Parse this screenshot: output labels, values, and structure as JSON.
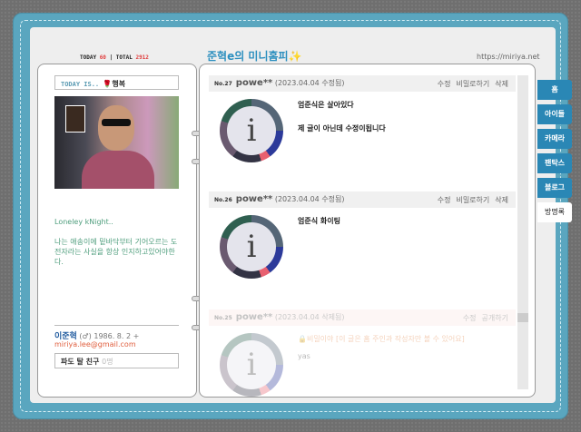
{
  "header": {
    "today_label": "TODAY",
    "today": "60",
    "total_label": "TOTAL",
    "total": "2912",
    "title": "준혁e의 미니홈피✨",
    "url": "https://miriya.net"
  },
  "profile": {
    "today_is": "TODAY IS..",
    "mood_icon": "🌹",
    "mood": "행복",
    "bio_title": "Loneley kNight..",
    "bio": "나는 애송이에 밑바닥부터 기어오르는 도전자라는 사실을 항상 인지하고있어야한다.",
    "name": "이준혁",
    "gender": "(♂)",
    "birth": "1986. 8. 2 +",
    "email": "miriya.lee@gmail.com",
    "friends_label": "파도 탈 친구",
    "friends_count": "0명"
  },
  "posts": [
    {
      "no": "No.27",
      "nick": "powe**",
      "date": "(2023.04.04 수정됨)",
      "actions": [
        "수정",
        "비밀로하기",
        "삭제"
      ],
      "lines": [
        "엄준식은 살아있다",
        "제 글이 아닌데 수정이됩니다"
      ]
    },
    {
      "no": "No.26",
      "nick": "powe**",
      "date": "(2023.04.04 수정됨)",
      "actions": [
        "수정",
        "비밀로하기",
        "삭제"
      ],
      "lines": [
        "엄준식 화이팅"
      ]
    },
    {
      "no": "No.25",
      "nick": "powe**",
      "date": "(2023.04.04 삭제됨)",
      "actions": [
        "수정",
        "공개하기"
      ],
      "secret": "🔒비밀이야 [이 글은 홈 주인과 작성자만 볼 수 있어요]",
      "lines": [
        "yas"
      ]
    }
  ],
  "tabs": [
    "홈",
    "아이들",
    "카메라",
    "팬탁스",
    "블로그",
    "방명록"
  ]
}
